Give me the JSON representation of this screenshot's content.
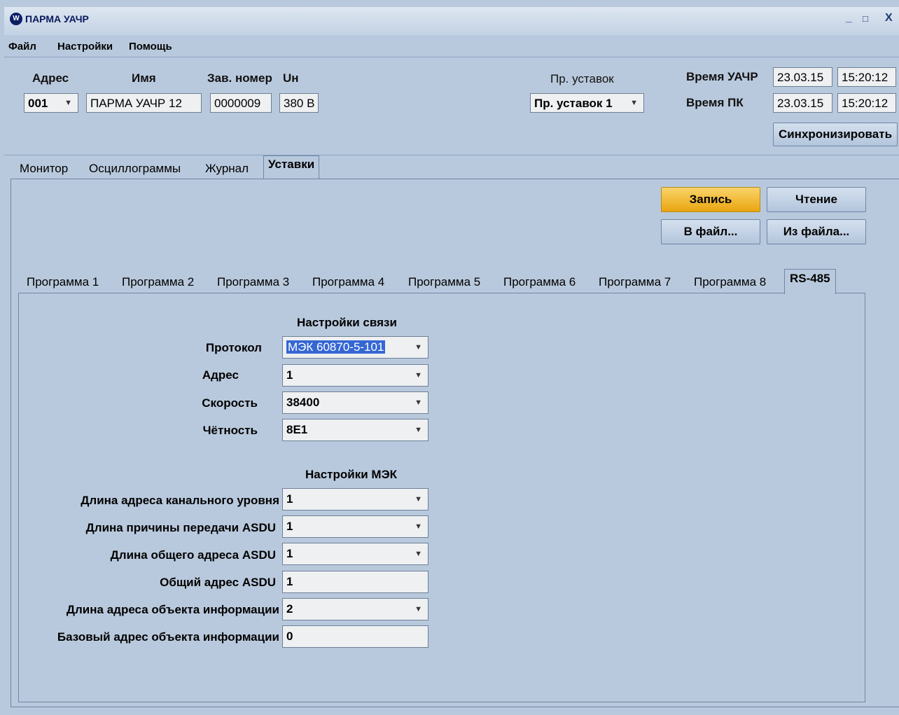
{
  "window": {
    "title": "ПАРМА УАЧР",
    "logo_text": "W",
    "minimize": "_",
    "maximize": "□",
    "close": "X"
  },
  "menu": [
    "Файл",
    "Настройки",
    "Помощь"
  ],
  "header": {
    "address_label": "Адрес",
    "address_value": "001",
    "name_label": "Имя",
    "name_value": "ПАРМА УАЧР 12",
    "serial_label": "Зав. номер",
    "serial_value": "0000009",
    "un_label": "Uн",
    "un_value": "380 В",
    "setpoints_label": "Пр. уставок",
    "setpoints_value": "Пр. уставок 1",
    "time_device_label": "Время УАЧР",
    "time_device_date": "23.03.15",
    "time_device_time": "15:20:12",
    "time_pc_label": "Время ПК",
    "time_pc_date": "23.03.15",
    "time_pc_time": "15:20:12",
    "sync_button": "Синхронизировать"
  },
  "main_tabs": [
    {
      "label": "Монитор",
      "active": false
    },
    {
      "label": "Осциллограммы",
      "active": false
    },
    {
      "label": "Журнал",
      "active": false
    },
    {
      "label": "Уставки",
      "active": true
    }
  ],
  "actions": {
    "write": "Запись",
    "read": "Чтение",
    "to_file": "В файл...",
    "from_file": "Из файла..."
  },
  "program_tabs": [
    {
      "label": "Программа 1",
      "active": false
    },
    {
      "label": "Программа 2",
      "active": false
    },
    {
      "label": "Программа 3",
      "active": false
    },
    {
      "label": "Программа 4",
      "active": false
    },
    {
      "label": "Программа 5",
      "active": false
    },
    {
      "label": "Программа 6",
      "active": false
    },
    {
      "label": "Программа 7",
      "active": false
    },
    {
      "label": "Программа 8",
      "active": false
    },
    {
      "label": "RS-485",
      "active": true
    }
  ],
  "comm_settings": {
    "title": "Настройки связи",
    "protocol_label": "Протокол",
    "protocol_value": "МЭК 60870-5-101",
    "address_label": "Адрес",
    "address_value": "1",
    "speed_label": "Скорость",
    "speed_value": "38400",
    "parity_label": "Чётность",
    "parity_value": "8E1"
  },
  "iec_settings": {
    "title": "Настройки МЭК",
    "link_addr_len_label": "Длина адреса канального уровня",
    "link_addr_len_value": "1",
    "cot_len_label": "Длина причины передачи ASDU",
    "cot_len_value": "1",
    "common_addr_len_label": "Длина общего адреса ASDU",
    "common_addr_len_value": "1",
    "common_addr_label": "Общий адрес ASDU",
    "common_addr_value": "1",
    "ioa_len_label": "Длина адреса объекта информации",
    "ioa_len_value": "2",
    "ioa_base_label": "Базовый адрес объекта информации",
    "ioa_base_value": "0"
  }
}
